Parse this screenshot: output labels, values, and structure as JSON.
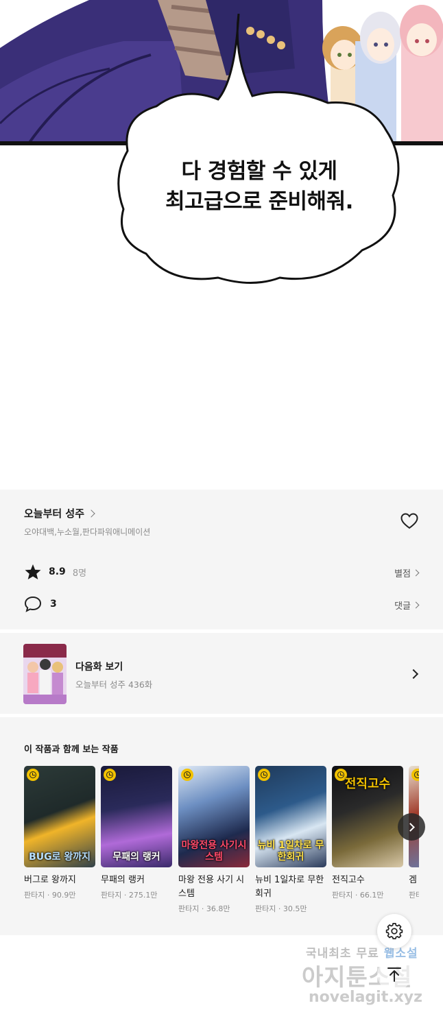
{
  "comic": {
    "speech_line1": "다 경험할 수 있게",
    "speech_line2": "최고급으로 준비해줘."
  },
  "series": {
    "title": "오늘부터 성주",
    "authors": "오야대백,누소월,판다파워애니메이션",
    "rating": "8.9",
    "rating_count": "8명",
    "rating_link": "별점",
    "comments": "3",
    "comments_link": "댓글",
    "favorite_icon": "heart-icon"
  },
  "next_episode": {
    "label": "다음화 보기",
    "subtitle": "오늘부터 성주 436화"
  },
  "recommendations": {
    "heading": "이 작품과 함께 보는 작품",
    "items": [
      {
        "title": "버그로 왕까지",
        "meta": "판타지 · 90.9만",
        "cover_text": "BUG로 왕까지"
      },
      {
        "title": "무패의 랭커",
        "meta": "판타지 · 275.1만",
        "cover_text": "무패의 랭커"
      },
      {
        "title": "마왕 전용 사기 시스템",
        "meta": "판타지 · 36.8만",
        "cover_text": "마왕전용 사기시스템"
      },
      {
        "title": "뉴비 1일차로 무한 회귀",
        "meta": "판타지 · 30.5만",
        "cover_text": "뉴비 1일차로 무한회귀"
      },
      {
        "title": "전직고수",
        "meta": "판타지 · 66.1만",
        "cover_text": "전직고수"
      },
      {
        "title": "겜",
        "meta": "판타",
        "cover_text": ""
      }
    ]
  },
  "watermark": {
    "line1_a": "국내최초 무료",
    "line1_b": "웹소설",
    "line2": "아지툰소설",
    "line3": "novelagit.xyz"
  },
  "colors": {
    "section_bg": "#f5f5f5",
    "badge_yellow": "#f2c200"
  }
}
